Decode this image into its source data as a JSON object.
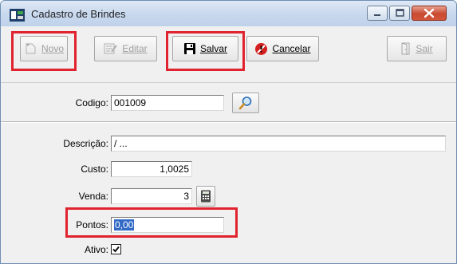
{
  "window": {
    "title": "Cadastro de Brindes"
  },
  "toolbar": {
    "novo_label": "Novo",
    "editar_label": "Editar",
    "salvar_label": "Salvar",
    "cancelar_label": "Cancelar",
    "sair_label": "Sair"
  },
  "form": {
    "codigo_label": "Codigo:",
    "codigo_value": "001009",
    "descricao_label": "Descrição:",
    "descricao_value": "/ ...",
    "custo_label": "Custo:",
    "custo_value": "1,0025",
    "venda_label": "Venda:",
    "venda_value": "3",
    "pontos_label": "Pontos:",
    "pontos_value": "0,00",
    "ativo_label": "Ativo:",
    "ativo_checked": true
  },
  "colors": {
    "highlight": "#e0232e",
    "selection": "#3169c6",
    "titlebar": "#c9d9ee"
  }
}
